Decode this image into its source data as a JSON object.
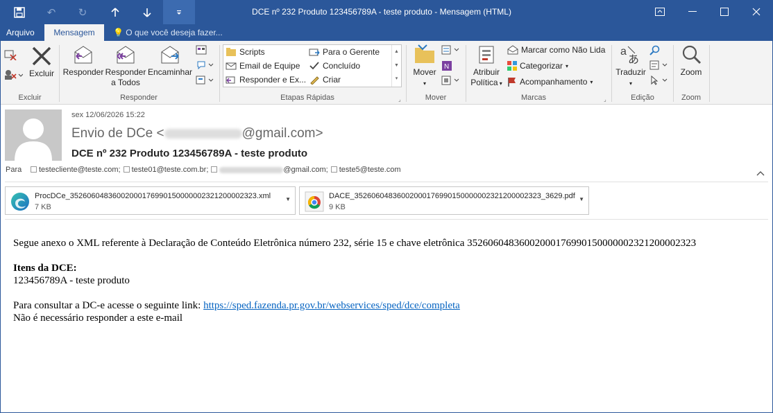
{
  "window": {
    "title": "DCE nº 232 Produto 123456789A - teste produto  -  Mensagem (HTML)"
  },
  "quick_access": {
    "save_icon": "save-icon",
    "undo_icon": "undo-icon",
    "redo_icon": "redo-icon",
    "up_icon": "arrow-up-icon",
    "down_icon": "arrow-down-icon",
    "customize_icon": "customize-qat-icon"
  },
  "tabs": {
    "arquivo": "Arquivo",
    "mensagem": "Mensagem",
    "tell_me": "O que você deseja fazer..."
  },
  "ribbon": {
    "excluir_group": "Excluir",
    "excluir_btn": "Excluir",
    "responder_group": "Responder",
    "responder_btn": "Responder",
    "responder_todos_line1": "Responder",
    "responder_todos_line2": "a Todos",
    "encaminhar_btn": "Encaminhar",
    "etapas_group": "Etapas Rápidas",
    "quick_steps": [
      "Scripts",
      "Para o Gerente",
      "Email de Equipe",
      "Concluído",
      "Responder e Ex...",
      "Criar"
    ],
    "mover_group": "Mover",
    "mover_btn": "Mover",
    "marcas_group": "Marcas",
    "atribuir_line1": "Atribuir",
    "atribuir_line2": "Política",
    "marcar_nao_lida": "Marcar como Não Lida",
    "categorizar": "Categorizar",
    "acompanhamento": "Acompanhamento",
    "edicao_group": "Edição",
    "traduzir_btn": "Traduzir",
    "zoom_group": "Zoom",
    "zoom_btn": "Zoom"
  },
  "message": {
    "date": "sex 12/06/2026 15:22",
    "from_prefix": "Envio de DCe <",
    "from_suffix": "@gmail.com>",
    "subject": "DCE nº 232 Produto 123456789A - teste produto",
    "to_label": "Para",
    "recipients": [
      "testecliente@teste.com;",
      "teste01@teste.com.br;",
      "@gmail.com;",
      "teste5@teste.com"
    ]
  },
  "attachments": [
    {
      "name": "ProcDCe_35260604836002000176990150000002321200002323.xml",
      "size": "7 KB",
      "icon": "edge-icon"
    },
    {
      "name": "DACE_35260604836002000176990150000002321200002323_3629.pdf",
      "size": "9 KB",
      "icon": "chrome-icon"
    }
  ],
  "body": {
    "intro": "Segue anexo o XML referente à Declaração de Conteúdo Eletrônica número 232, série 15 e chave eletrônica 35260604836002000176990150000002321200002323",
    "items_heading": "Itens da DCE:",
    "item1": "123456789A - teste produto",
    "consult_prefix": "Para consultar a DC-e acesse o seguinte link: ",
    "consult_link": "https://sped.fazenda.pr.gov.br/webservices/sped/dce/completa",
    "no_reply": "Não é necessário responder a este e-mail"
  }
}
